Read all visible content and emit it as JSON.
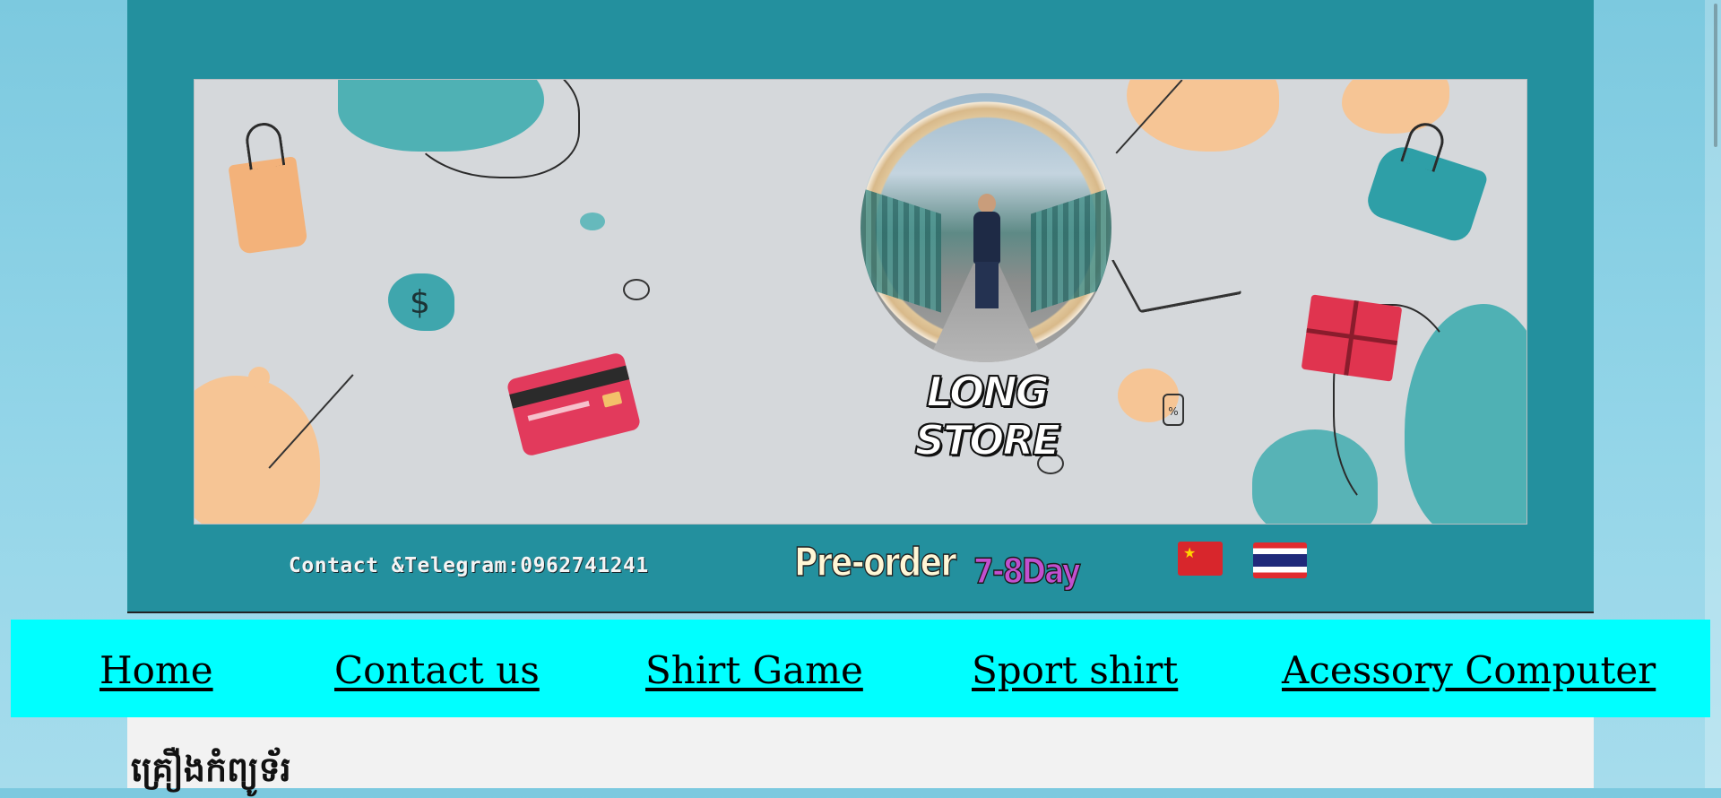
{
  "banner": {
    "brand_name": "LONG STORE",
    "contact_text": "Contact &Telegram:0962741241",
    "preorder_label": "Pre-order",
    "delivery_days": "7-8Day",
    "flags": [
      "china-flag-icon",
      "thailand-flag-icon"
    ],
    "colors": {
      "frame": "#23909e",
      "panel": "#d5d8db",
      "teal_blob": "#4fb1b4",
      "peach_blob": "#f6c595",
      "red_card": "#e23a5c"
    }
  },
  "nav": {
    "background": "#00ffff",
    "items": [
      {
        "label": "Home"
      },
      {
        "label": "Contact us"
      },
      {
        "label": "Shirt Game"
      },
      {
        "label": "Sport shirt"
      },
      {
        "label": "Acessory Computer"
      }
    ]
  },
  "content": {
    "heading": "គ្រឿងកំព្យូទ័រ"
  }
}
